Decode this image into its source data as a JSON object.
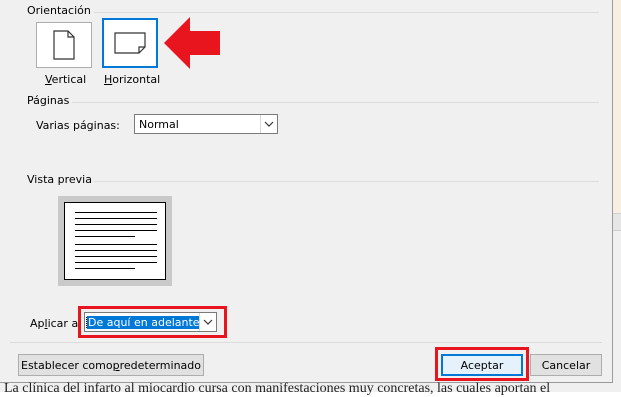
{
  "background": {
    "document_text": "La clínica del infarto al miocardio cursa con manifestaciones muy concretas, las cuales aportan el"
  },
  "orientation": {
    "title": "Orientación",
    "vertical_label": "Vertical",
    "horizontal_label": "Horizontal",
    "selected": "Horizontal"
  },
  "pages": {
    "title": "Páginas",
    "multiple_pages_label": "Varias páginas:",
    "multiple_pages_value": "Normal"
  },
  "preview": {
    "title": "Vista previa"
  },
  "apply": {
    "label": "Aplicar a:",
    "value": "De aquí en adelante"
  },
  "buttons": {
    "set_default": "Establecer como predeterminado",
    "ok": "Aceptar",
    "cancel": "Cancelar"
  },
  "colors": {
    "highlight_red": "#e8141e",
    "selection_blue": "#0078d7",
    "dialog_bg": "#f0f0f0"
  }
}
